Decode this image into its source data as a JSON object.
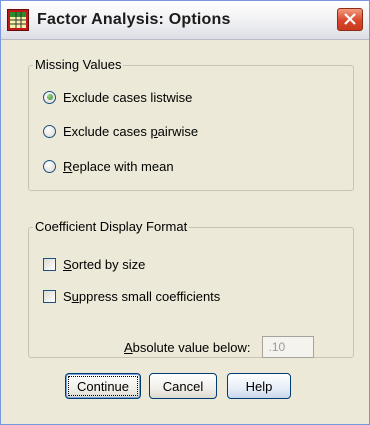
{
  "window": {
    "title": "Factor Analysis: Options",
    "icon": "spss-dialog-icon",
    "close_icon": "close-icon"
  },
  "missing_values": {
    "legend": "Missing Values",
    "options": [
      {
        "pre": "",
        "key": "",
        "post": "Exclude cases listwise",
        "checked": true
      },
      {
        "pre": "Exclude cases ",
        "key": "p",
        "post": "airwise",
        "checked": false
      },
      {
        "pre": "",
        "key": "R",
        "post": "eplace with mean",
        "checked": false
      }
    ]
  },
  "coefficient_display": {
    "legend": "Coefficient Display Format",
    "sorted": {
      "pre": "",
      "key": "S",
      "post": "orted by size",
      "checked": false
    },
    "suppress": {
      "pre": "S",
      "key": "u",
      "post": "ppress small coefficients",
      "checked": false
    },
    "absolute": {
      "pre": "",
      "key": "A",
      "post": "bsolute value below:",
      "value": ".10"
    }
  },
  "buttons": {
    "continue": "Continue",
    "cancel": "Cancel",
    "help": "Help"
  },
  "colors": {
    "dialog_bg": "#ece9d8",
    "close_button": "#d8462b",
    "radio_selected": "#2f8a1f"
  }
}
